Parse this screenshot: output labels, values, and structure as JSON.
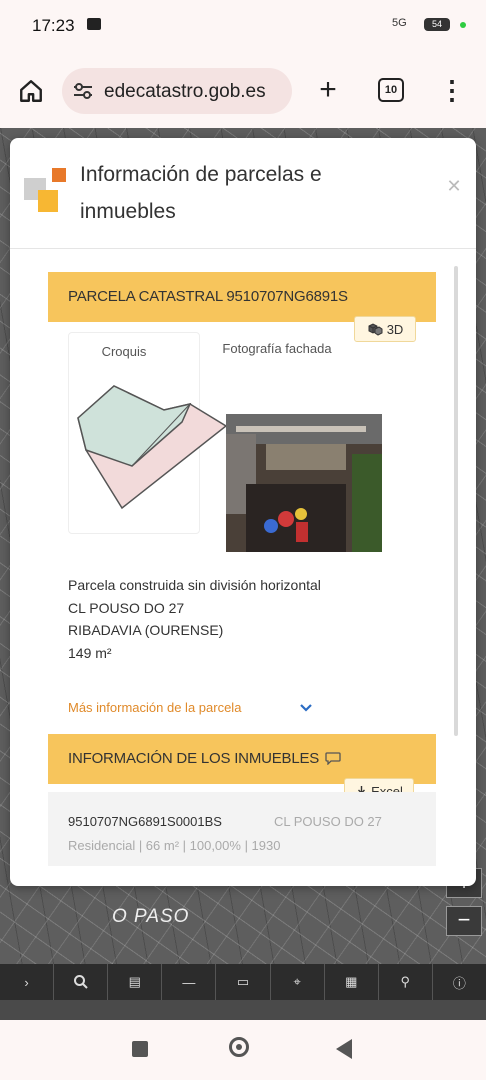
{
  "status_bar": {
    "time": "17:23",
    "signal": "5G",
    "battery": "54"
  },
  "browser": {
    "url": "edecatastro.gob.es",
    "tab_count": "10"
  },
  "dialog": {
    "title": "Información de parcelas e inmuebles",
    "parcel_section": {
      "header": "PARCELA CATASTRAL 9510707NG6891S",
      "btn_3d": "3D",
      "croquis_caption": "Croquis",
      "foto_caption": "Fotografía fachada",
      "info_lines": [
        "Parcela construida sin división horizontal",
        "CL POUSO DO 27",
        "RIBADAVIA (OURENSE)",
        "149 m²"
      ],
      "more_link": "Más información de la parcela"
    },
    "properties_section": {
      "header": "INFORMACIÓN DE LOS INMUEBLES",
      "btn_excel": "Excel",
      "rows": [
        {
          "reference": "9510707NG6891S0001BS",
          "address": "CL POUSO DO 27",
          "details": "Residencial | 66 m² | 100,00% | 1930"
        }
      ]
    }
  },
  "map": {
    "street_label": "O PASO",
    "zoom_in": "+",
    "zoom_out": "−"
  },
  "icons": [
    "home-icon",
    "tune-icon",
    "plus-icon",
    "tabs-icon",
    "more-vert-icon",
    "close-icon",
    "cube-icon",
    "chevron-down-icon",
    "comment-icon",
    "download-icon",
    "search-icon",
    "layers-icon",
    "measure-icon",
    "car-icon",
    "pin-icon",
    "info-icon",
    "square-nav-icon",
    "home-nav-icon",
    "back-nav-icon"
  ],
  "colors": {
    "accent": "#f7c55c",
    "link": "#e08a2a"
  }
}
